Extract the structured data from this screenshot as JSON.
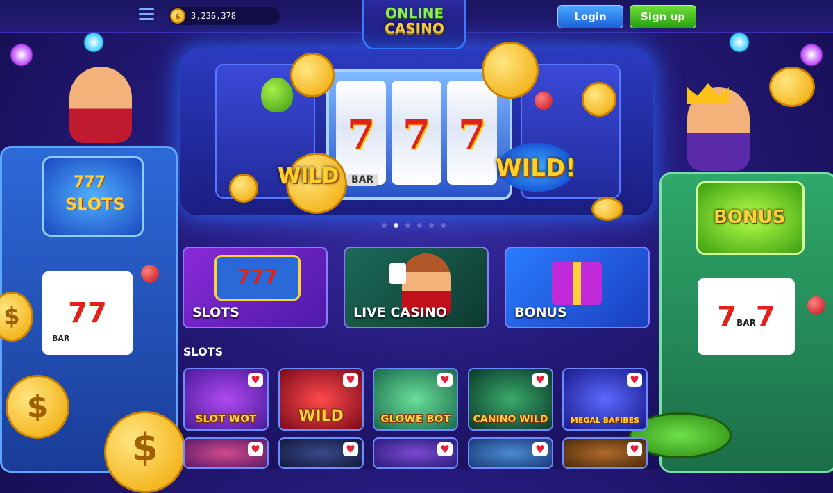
{
  "header": {
    "balance": "3,236,378",
    "logo_line1": "ONLINE",
    "logo_line2": "CASINO",
    "login_label": "Login",
    "signup_label": "Sign up"
  },
  "hero": {
    "wild_left": "WILD",
    "wild_right": "WILD!",
    "reel_symbol": "7",
    "reel_bar": "BAR",
    "slides_total": 6,
    "slide_active": 2
  },
  "left_machine": {
    "screen_top": "777",
    "screen_label": "SLOTS",
    "bar": "BAR"
  },
  "right_machine": {
    "screen_label": "BONUS",
    "bar": "BAR"
  },
  "categories": [
    {
      "label": "SLOTS"
    },
    {
      "label": "LIVE CASINO"
    },
    {
      "label": "BONUS"
    }
  ],
  "slots_section": {
    "title": "SLOTS",
    "games": [
      {
        "name": "SLOT WOT"
      },
      {
        "name": "WILD"
      },
      {
        "name": "GLOWE BOT"
      },
      {
        "name": "CANINO WILD"
      },
      {
        "name": "MEGAL BAFIBES"
      }
    ]
  },
  "colors": {
    "login": "#1b62d8",
    "signup": "#28a010",
    "accent_gold": "#ffd23a"
  }
}
